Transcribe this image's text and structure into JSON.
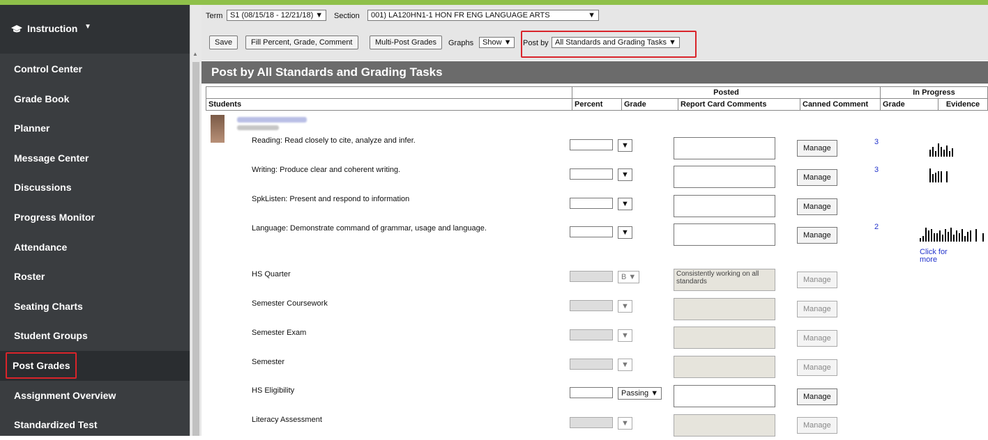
{
  "sidebar": {
    "section_title": "Instruction",
    "items": [
      {
        "label": "Control Center"
      },
      {
        "label": "Grade Book"
      },
      {
        "label": "Planner"
      },
      {
        "label": "Message Center"
      },
      {
        "label": "Discussions"
      },
      {
        "label": "Progress Monitor"
      },
      {
        "label": "Attendance"
      },
      {
        "label": "Roster"
      },
      {
        "label": "Seating Charts"
      },
      {
        "label": "Student Groups"
      },
      {
        "label": "Post Grades",
        "active": true
      },
      {
        "label": "Assignment Overview"
      },
      {
        "label": "Standardized Test"
      }
    ]
  },
  "toolbar": {
    "term_label": "Term",
    "term_value": "S1 (08/15/18 - 12/21/18) ▼",
    "section_label": "Section",
    "section_value": "001) LA120HN1-1 HON FR ENG LANGUAGE ARTS",
    "save": "Save",
    "fill": "Fill Percent, Grade, Comment",
    "multipost": "Multi-Post Grades",
    "graphs_label": "Graphs",
    "graphs_value": "Show ▼",
    "postby_label": "Post by",
    "postby_value": "All Standards and Grading Tasks ▼"
  },
  "banner": "Post by All Standards and Grading Tasks",
  "table": {
    "group_posted": "Posted",
    "group_inprogress": "In Progress",
    "col_students": "Students",
    "col_percent": "Percent",
    "col_grade": "Grade",
    "col_rcc": "Report Card Comments",
    "col_canned": "Canned Comment",
    "col_ip_grade": "Grade",
    "col_evidence": "Evidence"
  },
  "rows": [
    {
      "label": "Reading: Read closely to cite, analyze and infer.",
      "grade": "▼",
      "count": "3",
      "disabled": false
    },
    {
      "label": "Writing: Produce clear and coherent writing.",
      "grade": "▼",
      "count": "3",
      "disabled": false
    },
    {
      "label": "SpkListen: Present and respond to information",
      "grade": "▼",
      "count": "",
      "disabled": false
    },
    {
      "label": "Language: Demonstrate command of grammar, usage and language.",
      "grade": "▼",
      "count": "2",
      "disabled": false
    },
    {
      "label": "HS Quarter",
      "grade": "B  ▼",
      "comment": "Consistently working on all standards",
      "disabled": true
    },
    {
      "label": "Semester Coursework",
      "grade": "▼",
      "disabled": true
    },
    {
      "label": "Semester Exam",
      "grade": "▼",
      "disabled": true
    },
    {
      "label": "Semester",
      "grade": "▼",
      "disabled": true
    },
    {
      "label": "HS Eligibility",
      "grade": "Passing  ▼",
      "disabled": false
    },
    {
      "label": "Literacy Assessment",
      "grade": "▼",
      "disabled": true
    }
  ],
  "manage_label": "Manage",
  "click_more": "Click for more",
  "colors": {
    "accent": "#8fc04a",
    "sidebar": "#3a3d40",
    "highlight": "#d9242a",
    "evidence": "#21891e",
    "link": "#2233cc"
  }
}
